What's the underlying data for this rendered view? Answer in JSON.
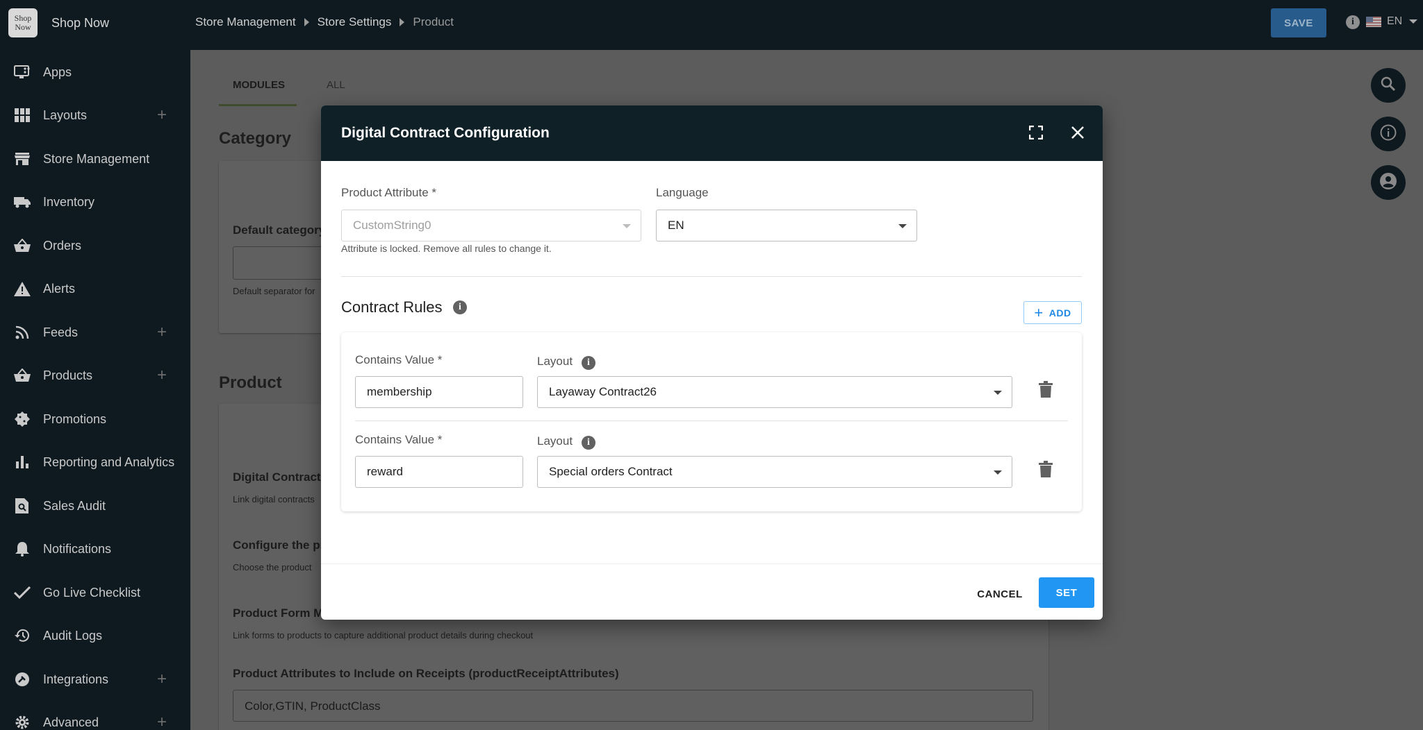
{
  "brand": {
    "logo_text": "Shop Now",
    "name": "Shop Now"
  },
  "breadcrumb": [
    "Store Management",
    "Store Settings",
    "Product"
  ],
  "topbar": {
    "save_label": "SAVE",
    "language": "EN"
  },
  "sidebar": {
    "items": [
      {
        "label": "Apps",
        "icon": "apps-monitor-icon",
        "plus": false
      },
      {
        "label": "Layouts",
        "icon": "grid-icon",
        "plus": true
      },
      {
        "label": "Store Management",
        "icon": "store-icon",
        "plus": false
      },
      {
        "label": "Inventory",
        "icon": "truck-icon",
        "plus": false
      },
      {
        "label": "Orders",
        "icon": "basket-icon",
        "plus": false
      },
      {
        "label": "Alerts",
        "icon": "warning-icon",
        "plus": false
      },
      {
        "label": "Feeds",
        "icon": "rss-icon",
        "plus": true
      },
      {
        "label": "Products",
        "icon": "basket-icon",
        "plus": true
      },
      {
        "label": "Promotions",
        "icon": "promotion-badge-icon",
        "plus": false
      },
      {
        "label": "Reporting and Analytics",
        "icon": "bar-chart-icon",
        "plus": false
      },
      {
        "label": "Sales Audit",
        "icon": "document-search-icon",
        "plus": false
      },
      {
        "label": "Notifications",
        "icon": "bell-icon",
        "plus": false
      },
      {
        "label": "Go Live Checklist",
        "icon": "check-icon",
        "plus": false
      },
      {
        "label": "Audit Logs",
        "icon": "history-icon",
        "plus": false
      },
      {
        "label": "Integrations",
        "icon": "integration-icon",
        "plus": true
      },
      {
        "label": "Advanced",
        "icon": "gear-icon",
        "plus": true
      }
    ]
  },
  "background": {
    "tabs": [
      "MODULES",
      "ALL"
    ],
    "category_title": "Category",
    "default_category_label": "Default category",
    "default_separator_help": "Default separator for",
    "product_title": "Product",
    "digital_contract_label": "Digital Contract",
    "digital_contract_help": "Link digital contracts",
    "configure_label": "Configure the pr",
    "configure_help": "Choose the product",
    "product_form_label": "Product Form M",
    "product_form_help": "Link forms to products to capture additional product details during checkout",
    "receipt_attrs_label": "Product Attributes to Include on Receipts (productReceiptAttributes)",
    "receipt_attrs_value": "Color,GTIN, ProductClass"
  },
  "modal": {
    "title": "Digital Contract Configuration",
    "product_attribute_label": "Product Attribute *",
    "product_attribute_value": "CustomString0",
    "product_attribute_helper": "Attribute is locked. Remove all rules to change it.",
    "language_label": "Language",
    "language_value": "EN",
    "rules_title": "Contract Rules",
    "add_label": "ADD",
    "rules": [
      {
        "contains_label": "Contains Value *",
        "contains_value": "membership",
        "layout_label": "Layout",
        "layout_value": "Layaway Contract26"
      },
      {
        "contains_label": "Contains Value *",
        "contains_value": "reward",
        "layout_label": "Layout",
        "layout_value": "Special orders Contract"
      }
    ],
    "cancel_label": "CANCEL",
    "set_label": "SET"
  },
  "colors": {
    "header_dark": "#102027",
    "accent_blue": "#2196f3",
    "sidebar_bg": "#0e1a20"
  }
}
